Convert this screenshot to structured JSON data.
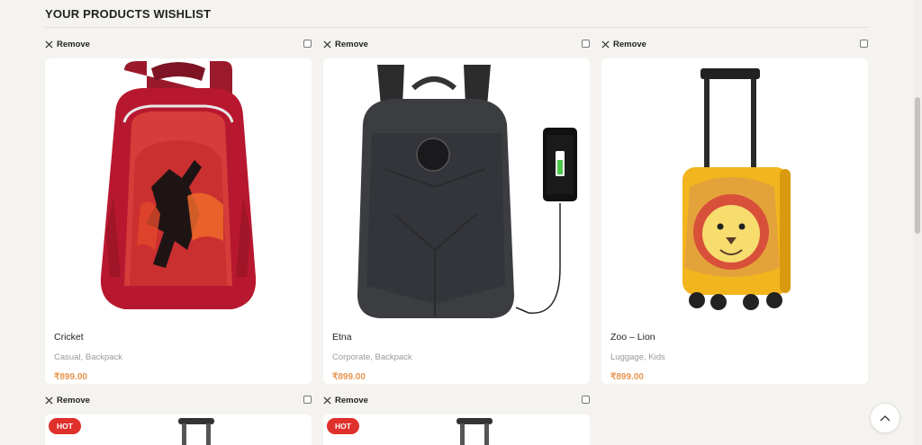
{
  "page": {
    "title": "YOUR PRODUCTS WISHLIST"
  },
  "remove_label": "Remove",
  "currency_color": "#e8954f",
  "badge_color": "#e0302b",
  "items": [
    {
      "name": "Cricket",
      "categories": [
        "Casual",
        "Backpack"
      ],
      "price": "₹899.00",
      "image": "red-cricket-backpack"
    },
    {
      "name": "Etna",
      "categories": [
        "Corporate",
        "Backpack"
      ],
      "price": "₹899.00",
      "image": "black-hardshell-backpack"
    },
    {
      "name": "Zoo – Lion",
      "categories": [
        "Luggage",
        "Kids"
      ],
      "price": "₹899.00",
      "image": "yellow-lion-kids-trolley"
    },
    {
      "badge": "HOT",
      "image": "trolley-luggage"
    },
    {
      "badge": "HOT",
      "image": "trolley-luggage"
    }
  ],
  "icons": {
    "remove": "close-icon",
    "scroll_top": "chevron-up-icon"
  }
}
